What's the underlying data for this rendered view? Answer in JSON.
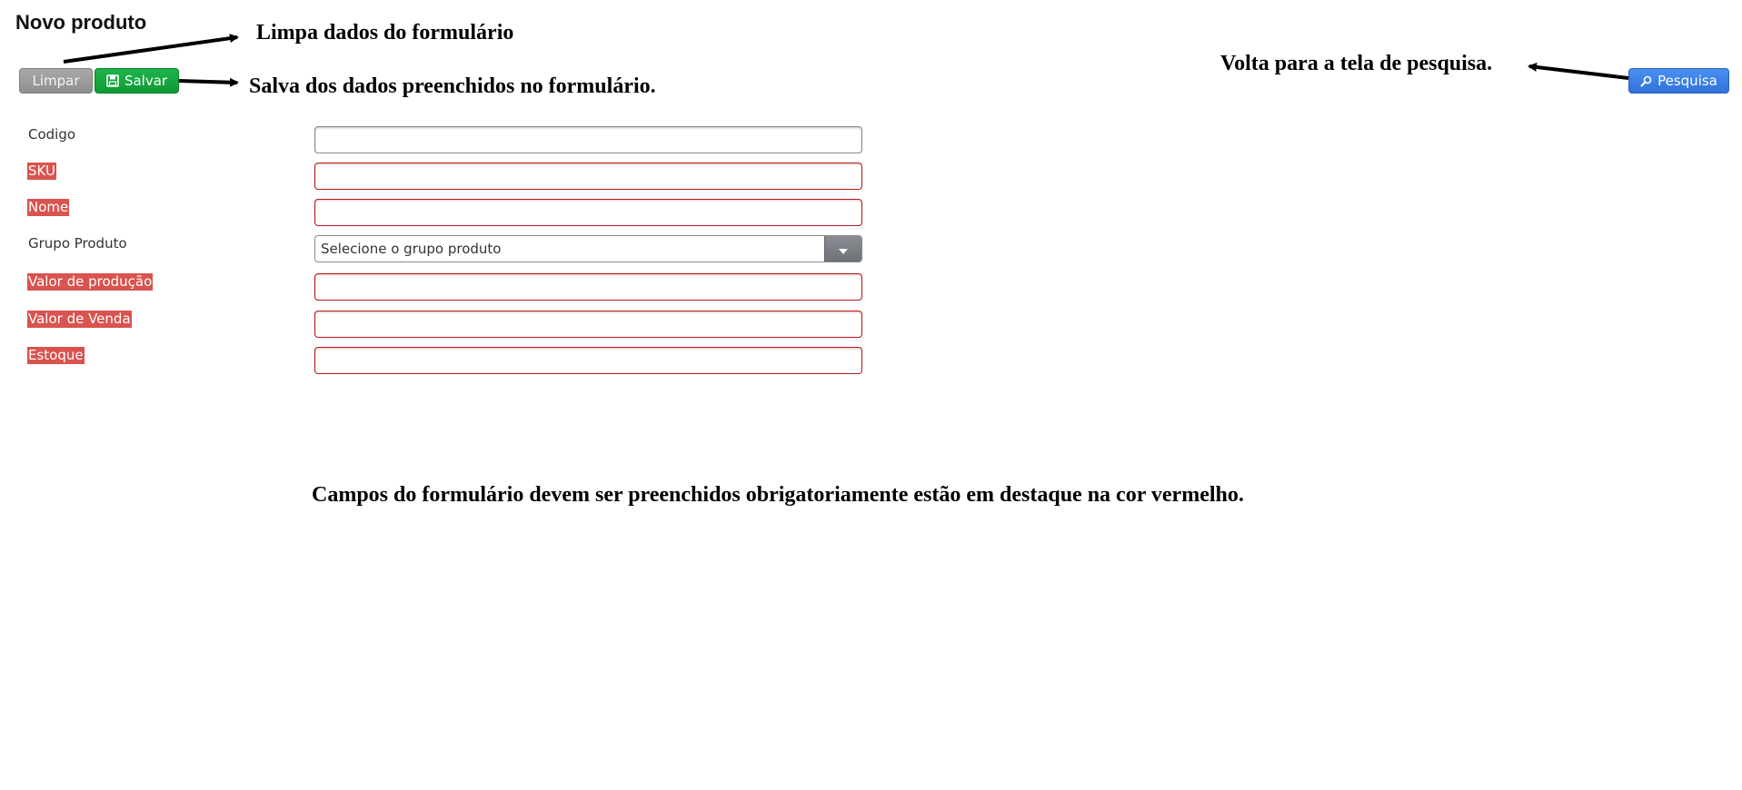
{
  "header": {
    "title": "Novo produto"
  },
  "toolbar": {
    "clear_label": "Limpar",
    "save_label": "Salvar",
    "search_label": "Pesquisa"
  },
  "annotations": {
    "clear": "Limpa dados do formulário",
    "save": "Salva dos dados preenchidos no formulário.",
    "search": "Volta para a tela de pesquisa.",
    "required": "Campos do formulário devem ser preenchidos obrigatoriamente estão em destaque na cor vermelho."
  },
  "form": {
    "fields": [
      {
        "label": "Codigo",
        "required": false,
        "value": ""
      },
      {
        "label": "SKU",
        "required": true,
        "value": ""
      },
      {
        "label": "Nome",
        "required": true,
        "value": ""
      },
      {
        "label": "Grupo Produto",
        "required": false,
        "type": "select",
        "placeholder": "Selecione o grupo produto"
      },
      {
        "label": "Valor de produção",
        "required": true,
        "value": ""
      },
      {
        "label": "Valor de Venda",
        "required": true,
        "value": ""
      },
      {
        "label": "Estoque",
        "required": true,
        "value": ""
      }
    ]
  },
  "colors": {
    "required_label_bg": "#d9534f",
    "required_border": "#b31b1b",
    "save_button": "#14a83e",
    "search_button": "#3a7fe6",
    "clear_button": "#9a9a9a"
  },
  "icons": {
    "save": "floppy-disk-icon",
    "search": "magnifier-icon",
    "dropdown": "chevron-down-icon"
  }
}
